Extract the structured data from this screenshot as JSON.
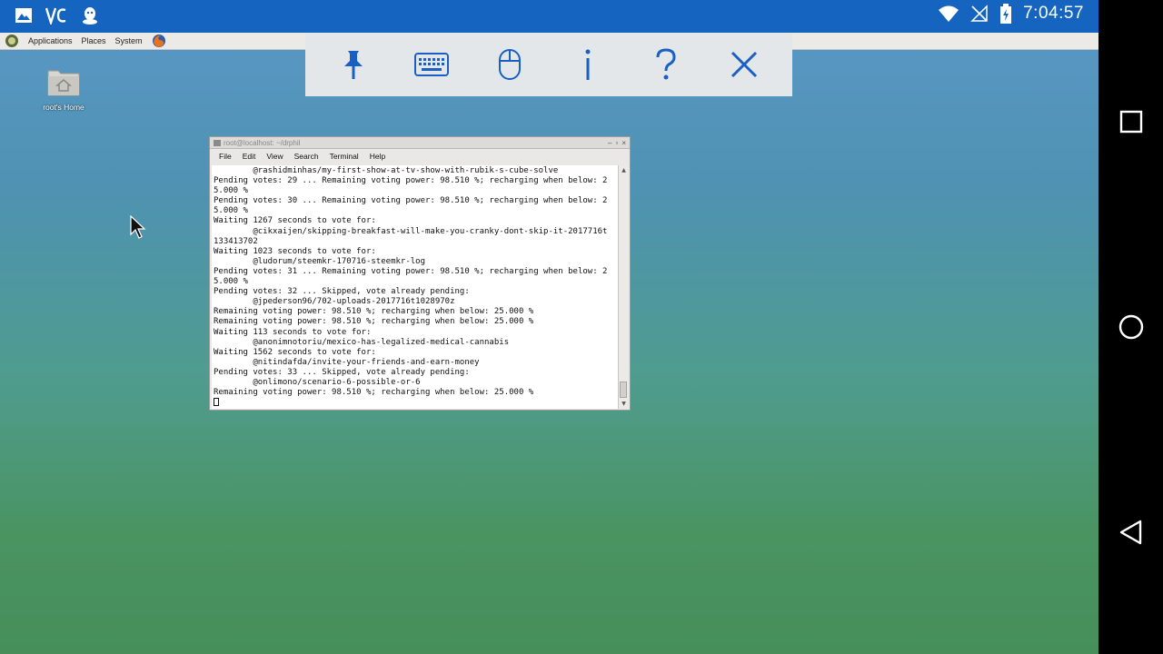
{
  "status_bar": {
    "time": "7:04:57",
    "left_icons": [
      "gallery-icon",
      "vnc-logo-icon",
      "notification-app-icon"
    ],
    "right_icons": [
      "wifi-icon",
      "no-signal-icon",
      "battery-charging-icon"
    ]
  },
  "desktop": {
    "panel": {
      "applications_label": "Applications",
      "places_label": "Places",
      "system_label": "System"
    },
    "home_icon_label": "root's Home"
  },
  "vnc_toolbar": {
    "buttons": [
      "pin-icon",
      "keyboard-icon",
      "mouse-icon",
      "info-icon",
      "help-icon",
      "close-icon"
    ],
    "accent_color": "#1a5fc4"
  },
  "terminal": {
    "title": "root@localhost: ~/drphil",
    "menu": [
      "File",
      "Edit",
      "View",
      "Search",
      "Terminal",
      "Help"
    ],
    "lines": [
      "        @rashidminhas/my-first-show-at-tv-show-with-rubik-s-cube-solve",
      "Pending votes: 29 ... Remaining voting power: 98.510 %; recharging when below: 2",
      "5.000 %",
      "Pending votes: 30 ... Remaining voting power: 98.510 %; recharging when below: 2",
      "5.000 %",
      "Waiting 1267 seconds to vote for:",
      "        @cikxaijen/skipping-breakfast-will-make-you-cranky-dont-skip-it-2017716t",
      "133413702",
      "Waiting 1023 seconds to vote for:",
      "        @ludorum/steemkr-170716-steemkr-log",
      "Pending votes: 31 ... Remaining voting power: 98.510 %; recharging when below: 2",
      "5.000 %",
      "Pending votes: 32 ... Skipped, vote already pending:",
      "        @jpederson96/702-uploads-2017716t1028970z",
      "Remaining voting power: 98.510 %; recharging when below: 25.000 %",
      "Remaining voting power: 98.510 %; recharging when below: 25.000 %",
      "Waiting 113 seconds to vote for:",
      "        @anonimnotoriu/mexico-has-legalized-medical-cannabis",
      "Waiting 1562 seconds to vote for:",
      "        @nitindafda/invite-your-friends-and-earn-money",
      "Pending votes: 33 ... Skipped, vote already pending:",
      "        @onlimono/scenario-6-possible-or-6",
      "Remaining voting power: 98.510 %; recharging when below: 25.000 %"
    ]
  },
  "nav_bar": {
    "buttons": [
      "recents-icon",
      "home-icon",
      "back-icon"
    ]
  }
}
